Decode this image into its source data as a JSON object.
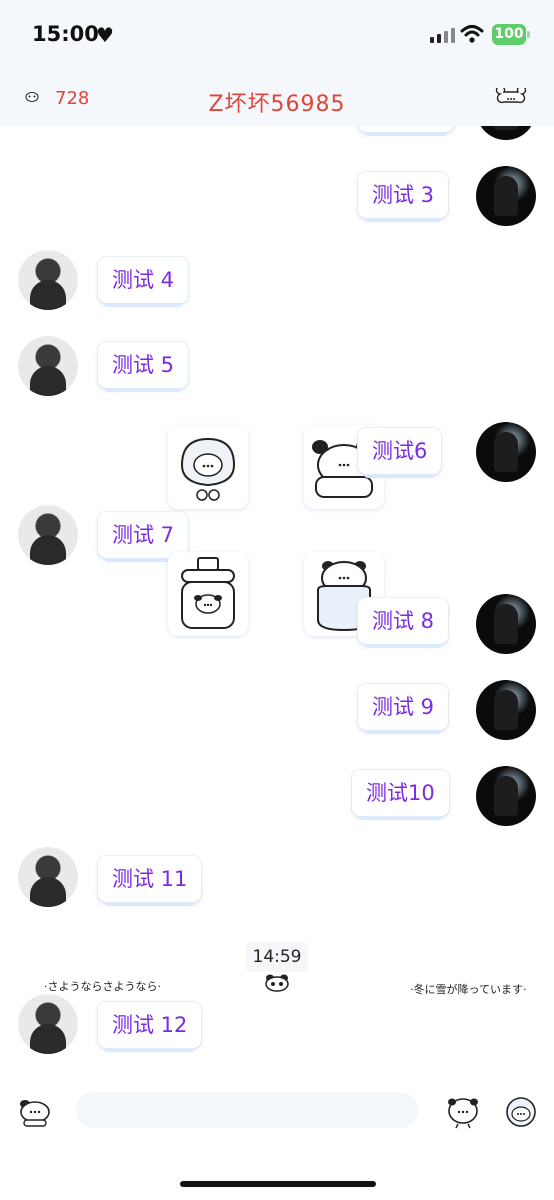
{
  "status_bar": {
    "time": "15:00",
    "heart": "♥",
    "battery": "100"
  },
  "header": {
    "left_count": "728",
    "title": "Z坏坏56985"
  },
  "messages": [
    {
      "side": "right",
      "text": "测试 3"
    },
    {
      "side": "left",
      "text": "测试 4"
    },
    {
      "side": "left",
      "text": "测试 5"
    },
    {
      "side": "right",
      "text": "测试6"
    },
    {
      "side": "left",
      "text": "测试 7"
    },
    {
      "side": "right",
      "text": "测试 8"
    },
    {
      "side": "right",
      "text": "测试 9"
    },
    {
      "side": "right",
      "text": "测试10"
    },
    {
      "side": "left",
      "text": "测试 11"
    },
    {
      "side": "left",
      "text": "测试 12"
    }
  ],
  "timestamp": "14:59",
  "decorations": {
    "left": "·さようならさようなら·",
    "right": "·冬に雪が降っています·"
  },
  "icons": {
    "header_left": "panda-face-icon",
    "header_right": "bone-icon",
    "input_left": "mascot-icon",
    "input_emoji": "emoji-icon",
    "input_plus": "plus-icon"
  },
  "colors": {
    "accent_purple": "#7b2be0",
    "header_red": "#e0453a",
    "header_bg": "#f4f7fb"
  }
}
